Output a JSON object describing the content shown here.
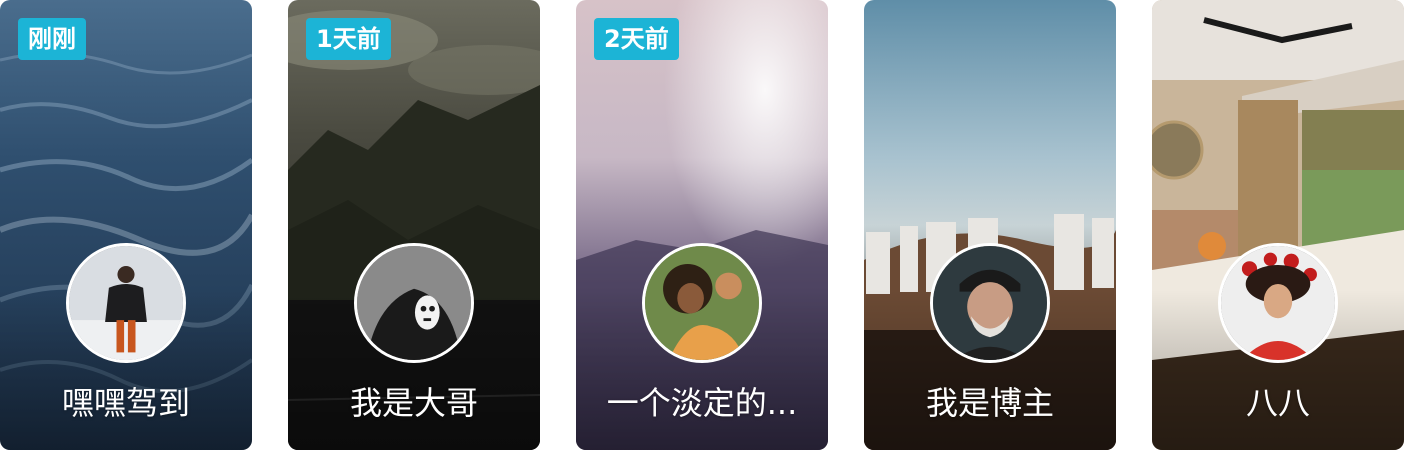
{
  "cards": [
    {
      "time_label": "刚刚",
      "name": "嘿嘿驾到",
      "background": "ocean-waves-photo",
      "avatar": "woman-in-orange-pants-photo"
    },
    {
      "time_label": "1天前",
      "name": "我是大哥",
      "background": "cloudy-mountain-photo",
      "avatar": "masked-figure-photo"
    },
    {
      "time_label": "2天前",
      "name": "一个淡定的...",
      "background": "misty-purple-sky-photo",
      "avatar": "curly-hair-woman-photo"
    },
    {
      "time_label": "",
      "name": "我是博主",
      "background": "hollywood-sign-photo",
      "avatar": "bearded-man-photo"
    },
    {
      "time_label": "",
      "name": "八八",
      "background": "bedroom-interior-photo",
      "avatar": "woman-lying-with-roses-photo"
    }
  ],
  "colors": {
    "badge": "#1cb4d6",
    "text": "#ffffff"
  }
}
